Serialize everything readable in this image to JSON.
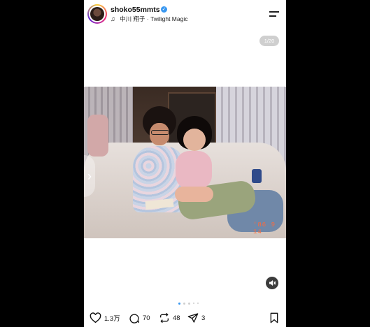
{
  "post": {
    "username": "shoko55mmts",
    "verified": true,
    "music": {
      "artist": "中川 翔子",
      "separator": "·",
      "track": "Twilight Magic"
    },
    "image_counter": "1/20",
    "date_stamp": "'86 9 14",
    "carousel": {
      "total_dots": 5,
      "active_index": 0
    }
  },
  "actions": {
    "likes": "1.3万",
    "comments": "70",
    "reposts": "48",
    "shares": "3"
  },
  "icons": [
    "verified-badge-icon",
    "music-note-icon",
    "menu-icon",
    "chevron-left-icon",
    "mute-icon",
    "heart-icon",
    "comment-icon",
    "repost-icon",
    "send-icon",
    "bookmark-icon"
  ],
  "colors": {
    "accent": "#3897f0",
    "date_stamp": "#ff6a3a"
  }
}
